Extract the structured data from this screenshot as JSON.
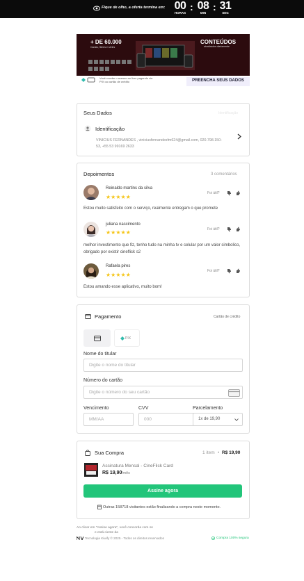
{
  "topbar": {
    "text": "Fique de olho, a oferta termina em:",
    "hours": "00",
    "hours_label": "HORAS",
    "minutes": "08",
    "minutes_label": "MIN",
    "seconds": "31",
    "seconds_label": "SEG",
    "sep": ":"
  },
  "banner": {
    "left_title": "+ DE 60.000",
    "left_sub": "Canais, filmes e séries",
    "right_title": "CONTEÚDOS",
    "right_sub": "atualizados diariamente",
    "pay_text": "Você recebe o acesso ao livro pagando via PIX ou cartão de crédito",
    "cta": "PREENCHA SEUS DADOS ABAIXO"
  },
  "dados": {
    "title": "Seus Dados",
    "right": "Identificação",
    "section": "Identificação",
    "line1": "VINICIUS FERNANDES , viniciusfernandesfm624@gmail.com, 020.798.150-",
    "line2": "53, +55 53 99169 2633"
  },
  "depo": {
    "title": "Depoimentos",
    "count": "3 comentários",
    "ago": "Foi útil?",
    "items": [
      {
        "name": "Reinaldo martins da silva",
        "text": "Estou muito satisfeito com o serviço, realmente entregam o que promete",
        "stars": "★★★★★"
      },
      {
        "name": "juliana nascimento",
        "text": "melhor investimento que fiz, tenho tudo na minha tv e celular por um valor simbolico, obrigado por existir cineflick s2",
        "stars": "★★★★★"
      },
      {
        "name": "Rafaela pires",
        "text": "Estou amando esse aplicativo, muito bom!",
        "stars": "★★★★★"
      }
    ]
  },
  "pagamento": {
    "title": "Pagamento",
    "method": "Cartão de crédito",
    "pix": "PIX",
    "holder_label": "Nome do titular",
    "holder_ph": "Digite o nome do titular",
    "card_label": "Número do cartão",
    "card_ph": "Digite o número do seu cartão",
    "exp_label": "Vencimento",
    "exp_ph": "MM/AA",
    "cvv_label": "CVV",
    "cvv_ph": "000",
    "inst_label": "Parcelamento",
    "inst_value": "1x de 19,90"
  },
  "compra": {
    "title": "Sua Compra",
    "items": "1 item",
    "dot": "•",
    "total": "R$ 19,90",
    "product": "Assinatura Mensal - CineFlick Card",
    "price": "R$ 19,90",
    "period": "/mês",
    "button": "Assine agora",
    "note": "Outras 158718 visitantes estão finalizando a compra neste momento."
  },
  "footer": {
    "terms1": "Ao clicar em \"Assine agora\", você concorda com os",
    "terms2": "e está ciente da",
    "brand": "Tecnologia Kiwify © 2025 - Todos os direitos reservados",
    "secure": "Compra 100% segura"
  },
  "colors": {
    "accent": "#22c57a",
    "star": "#f5c518",
    "topbar": "#0b0b0b"
  }
}
